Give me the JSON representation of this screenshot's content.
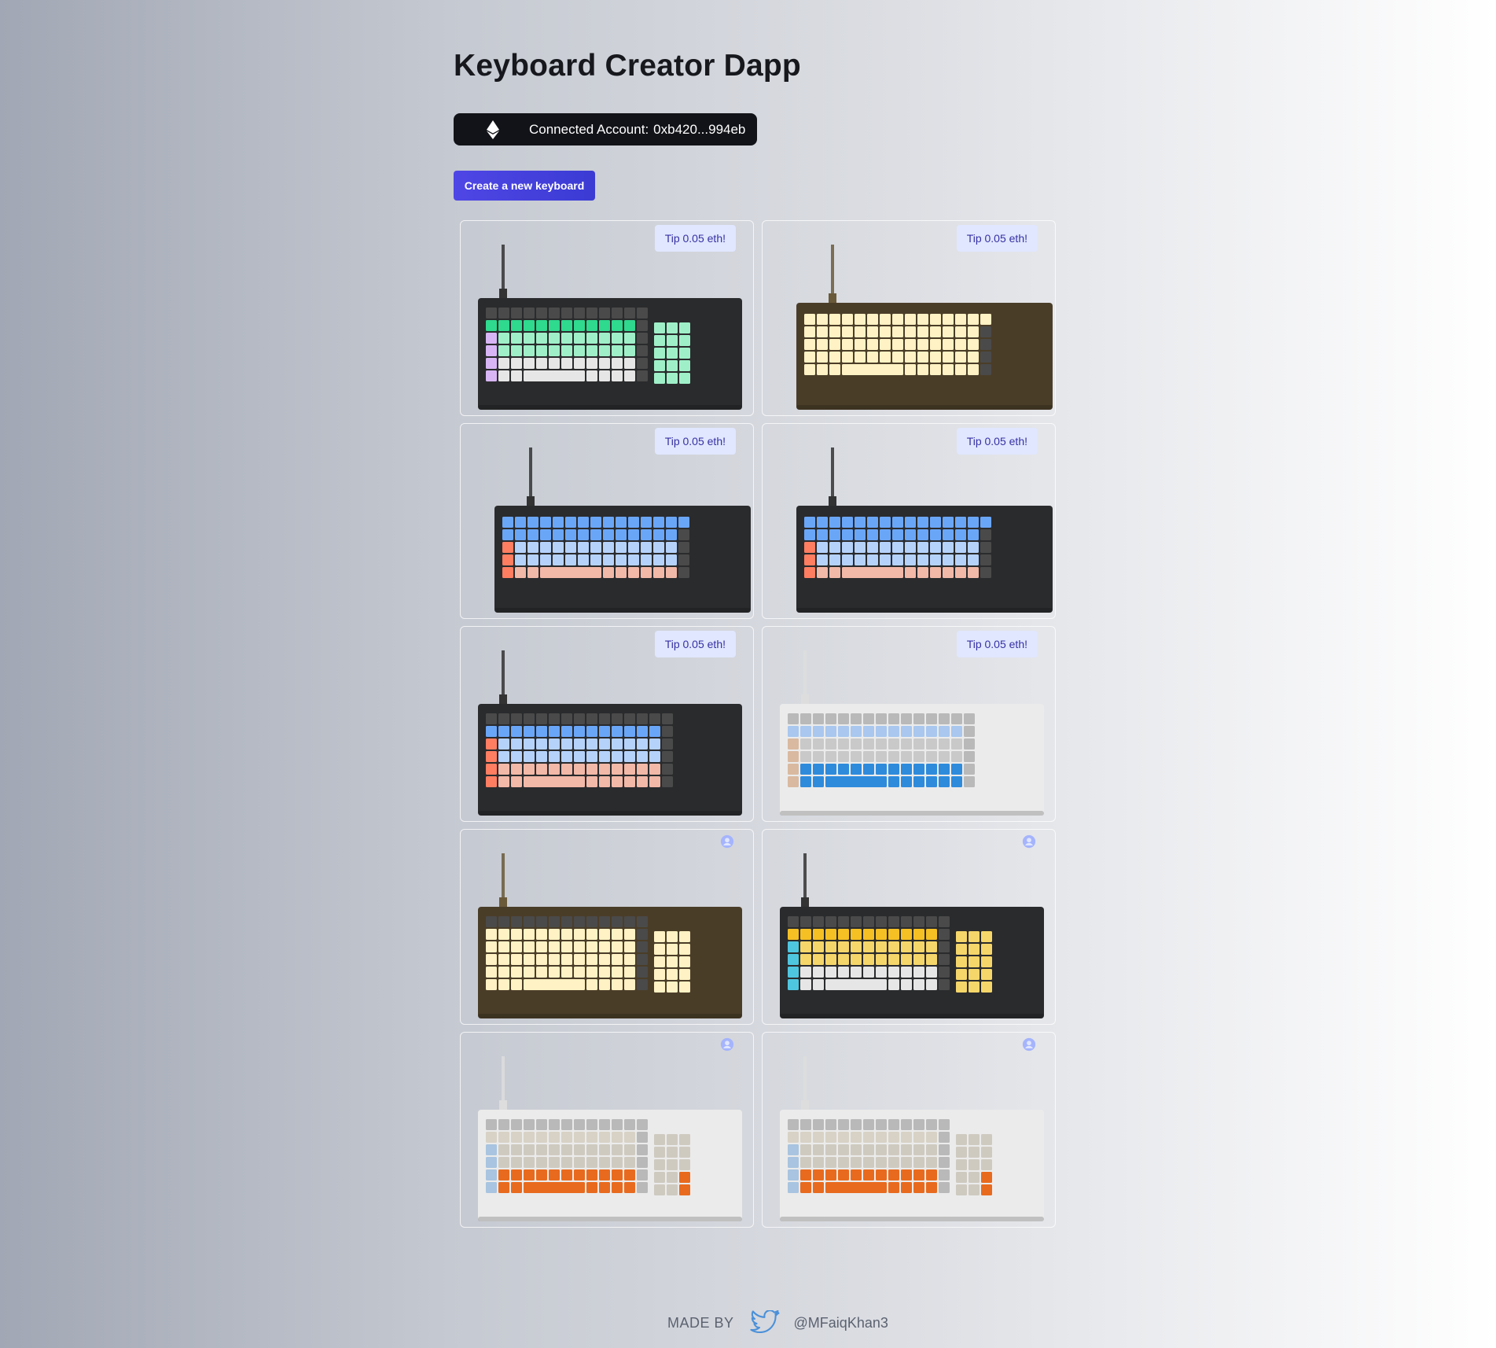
{
  "header": {
    "title": "Keyboard Creator Dapp"
  },
  "account": {
    "label": "Connected Account:",
    "address": "0xb420...994eb",
    "icon": "ethereum-icon"
  },
  "actions": {
    "create_label": "Create a new keyboard"
  },
  "keyboards": [
    {
      "case": "#2a2b2d",
      "cable": "#333333",
      "layout": "full",
      "keycaps": [
        "#2fd98e",
        "#9ff0c8",
        "#d8b6f5",
        "#e6e6e6"
      ],
      "tip": "Tip 0.05 eth!"
    },
    {
      "case": "#4a3d28",
      "cable": "#6b5a3a",
      "layout": "compact",
      "keycaps": [
        "#fff2c4",
        "#fff2c4",
        "#fff2c4",
        "#fff2c4"
      ],
      "tip": "Tip 0.05 eth!"
    },
    {
      "case": "#2a2b2d",
      "cable": "#333333",
      "layout": "compact",
      "keycaps": [
        "#6aa6f8",
        "#b5d2fb",
        "#ff7e62",
        "#f2b8a8"
      ],
      "tip": "Tip 0.05 eth!"
    },
    {
      "case": "#2a2b2d",
      "cable": "#333333",
      "layout": "compact",
      "keycaps": [
        "#6aa6f8",
        "#b5d2fb",
        "#ff7e62",
        "#f2b8a8"
      ],
      "tip": "Tip 0.05 eth!"
    },
    {
      "case": "#2a2b2d",
      "cable": "#333333",
      "layout": "tkl",
      "keycaps": [
        "#6aa6f8",
        "#b5d2fb",
        "#ff7e62",
        "#f2b8a8"
      ],
      "tip": "Tip 0.05 eth!"
    },
    {
      "case": "#ebebeb",
      "cable": "#dddddd",
      "layout": "tkl",
      "keycaps": [
        "#a9c7ef",
        "#c9c9c9",
        "#d9b9a0",
        "#2e8bdc"
      ],
      "tip": "Tip 0.05 eth!"
    },
    {
      "case": "#4a3d28",
      "cable": "#6b5a3a",
      "layout": "full",
      "keycaps": [
        "#fff2c4",
        "#fff2c4",
        "#fff2c4",
        "#fff2c4"
      ],
      "owner_icon": "user-circle-icon"
    },
    {
      "case": "#2a2b2d",
      "cable": "#333333",
      "layout": "full",
      "keycaps": [
        "#f5c023",
        "#f5d66a",
        "#4fc6e0",
        "#e6e6e6"
      ],
      "owner_icon": "user-circle-icon"
    },
    {
      "case": "#ebebeb",
      "cable": "#dddddd",
      "layout": "full",
      "keycaps": [
        "#d8d2c6",
        "#cfcac0",
        "#a8c4e0",
        "#e86a1e"
      ],
      "owner_icon": "user-circle-icon"
    },
    {
      "case": "#ebebeb",
      "cable": "#dddddd",
      "layout": "full",
      "keycaps": [
        "#d8d2c6",
        "#cfcac0",
        "#a8c4e0",
        "#e86a1e"
      ],
      "owner_icon": "user-circle-icon"
    }
  ],
  "footer": {
    "made_by": "MADE BY",
    "twitter_icon": "twitter-icon",
    "handle": "@MFaiqKhan3"
  }
}
